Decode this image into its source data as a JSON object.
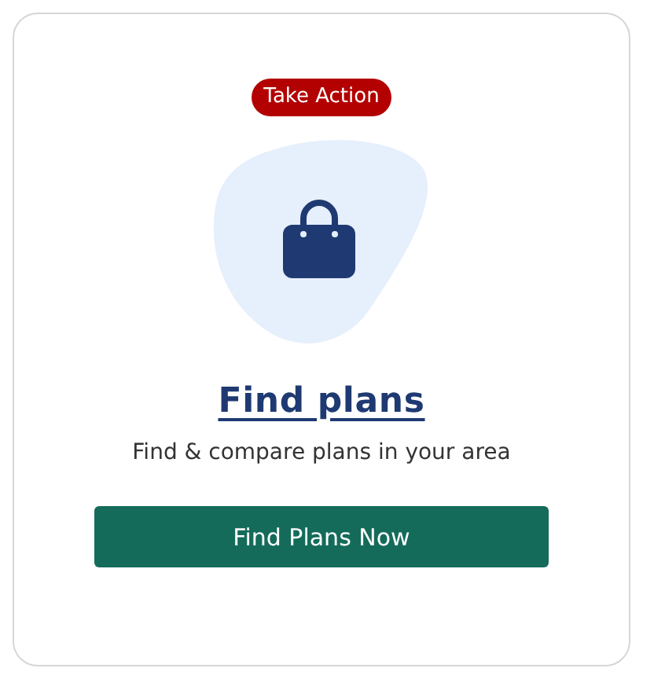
{
  "badge": "Take Action",
  "title": "Find plans",
  "description": "Find & compare plans in your area",
  "button": "Find Plans Now"
}
